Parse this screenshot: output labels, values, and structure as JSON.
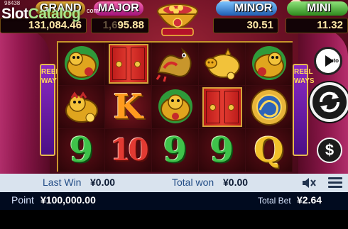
{
  "watermark": {
    "logo_main": "Slot",
    "logo_alt": "Catalog",
    "logo_suffix": "com",
    "small_id": "98438"
  },
  "jackpots": {
    "grand": {
      "label": "GRAND",
      "value": "131,084.46"
    },
    "major": {
      "label": "MAJOR",
      "value": "95.88",
      "value_prefix": "1,6"
    },
    "minor": {
      "label": "MINOR",
      "value": "30.51"
    },
    "mini": {
      "label": "MINI",
      "value": "11.32"
    }
  },
  "center_pot": {
    "icon": "treasure-pot-icon"
  },
  "side_banners": {
    "left": [
      "REEL",
      "WAYS"
    ],
    "right": [
      "REEL",
      "WAYS"
    ]
  },
  "reels": {
    "rows": [
      [
        "golden-lion-dog-icon",
        "red-door-icon",
        "dragon-icon",
        "golden-pig-icon",
        "golden-lion-dog-icon"
      ],
      [
        "golden-lion-dog-icon",
        "K",
        "golden-lion-dog-icon",
        "red-door-icon",
        "golden-dragon-coin-icon"
      ],
      [
        "9",
        "10",
        "9",
        "9",
        "Q"
      ]
    ]
  },
  "controls": {
    "auto_label": "auto",
    "spin_icon": "spin-arrows-icon",
    "bet_symbol": "$"
  },
  "info_bar": {
    "last_win_label": "Last Win",
    "last_win_value": "¥0.00",
    "total_won_label": "Total won",
    "total_won_value": "¥0.00"
  },
  "status_bar": {
    "point_label": "Point",
    "point_value": "¥100,000.00",
    "total_bet_label": "Total Bet",
    "total_bet_value": "¥2.64"
  },
  "colors": {
    "info_bar_bg": "#d9e3ee",
    "status_bar_bg": "#010b1f",
    "nine_green": "#3fc24a",
    "ten_red": "#e23a32",
    "q_gold": "#f2c12a",
    "k_orange": "#ff9b1e"
  }
}
